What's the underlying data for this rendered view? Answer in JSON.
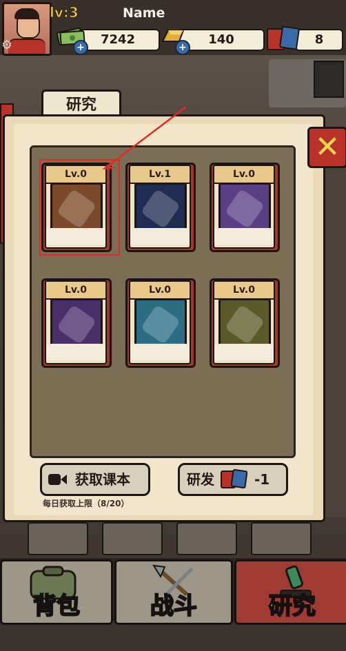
{
  "header": {
    "level": "lv:3",
    "name": "Name",
    "money": "7242",
    "gold": "140",
    "books": "8"
  },
  "panel": {
    "tab_label": "研究",
    "cards": [
      {
        "level": "Lv.0",
        "item": "bottle-icon",
        "pic_color": "#7a4a2a"
      },
      {
        "level": "Lv.1",
        "item": "battery-icon",
        "pic_color": "#1f2d52"
      },
      {
        "level": "Lv.0",
        "item": "stone-icon",
        "pic_color": "#5a3f86"
      },
      {
        "level": "Lv.0",
        "item": "log-icon",
        "pic_color": "#4a2e6a"
      },
      {
        "level": "Lv.0",
        "item": "talisman-icon",
        "pic_color": "#2c6d82"
      },
      {
        "level": "Lv.0",
        "item": "flashlight-icon",
        "pic_color": "#5c5a2a"
      }
    ]
  },
  "actions": {
    "get_textbook": "获取课本",
    "develop": "研发",
    "develop_cost": "-1",
    "daily_quota": "每日获取上限（8/20）"
  },
  "nav": {
    "bag": "背包",
    "battle": "战斗",
    "research": "研究"
  },
  "colors": {
    "accent_red": "#b8322a",
    "gold": "#f5d64a",
    "parchment": "#ead8b6",
    "highlight": "#e02a22"
  }
}
